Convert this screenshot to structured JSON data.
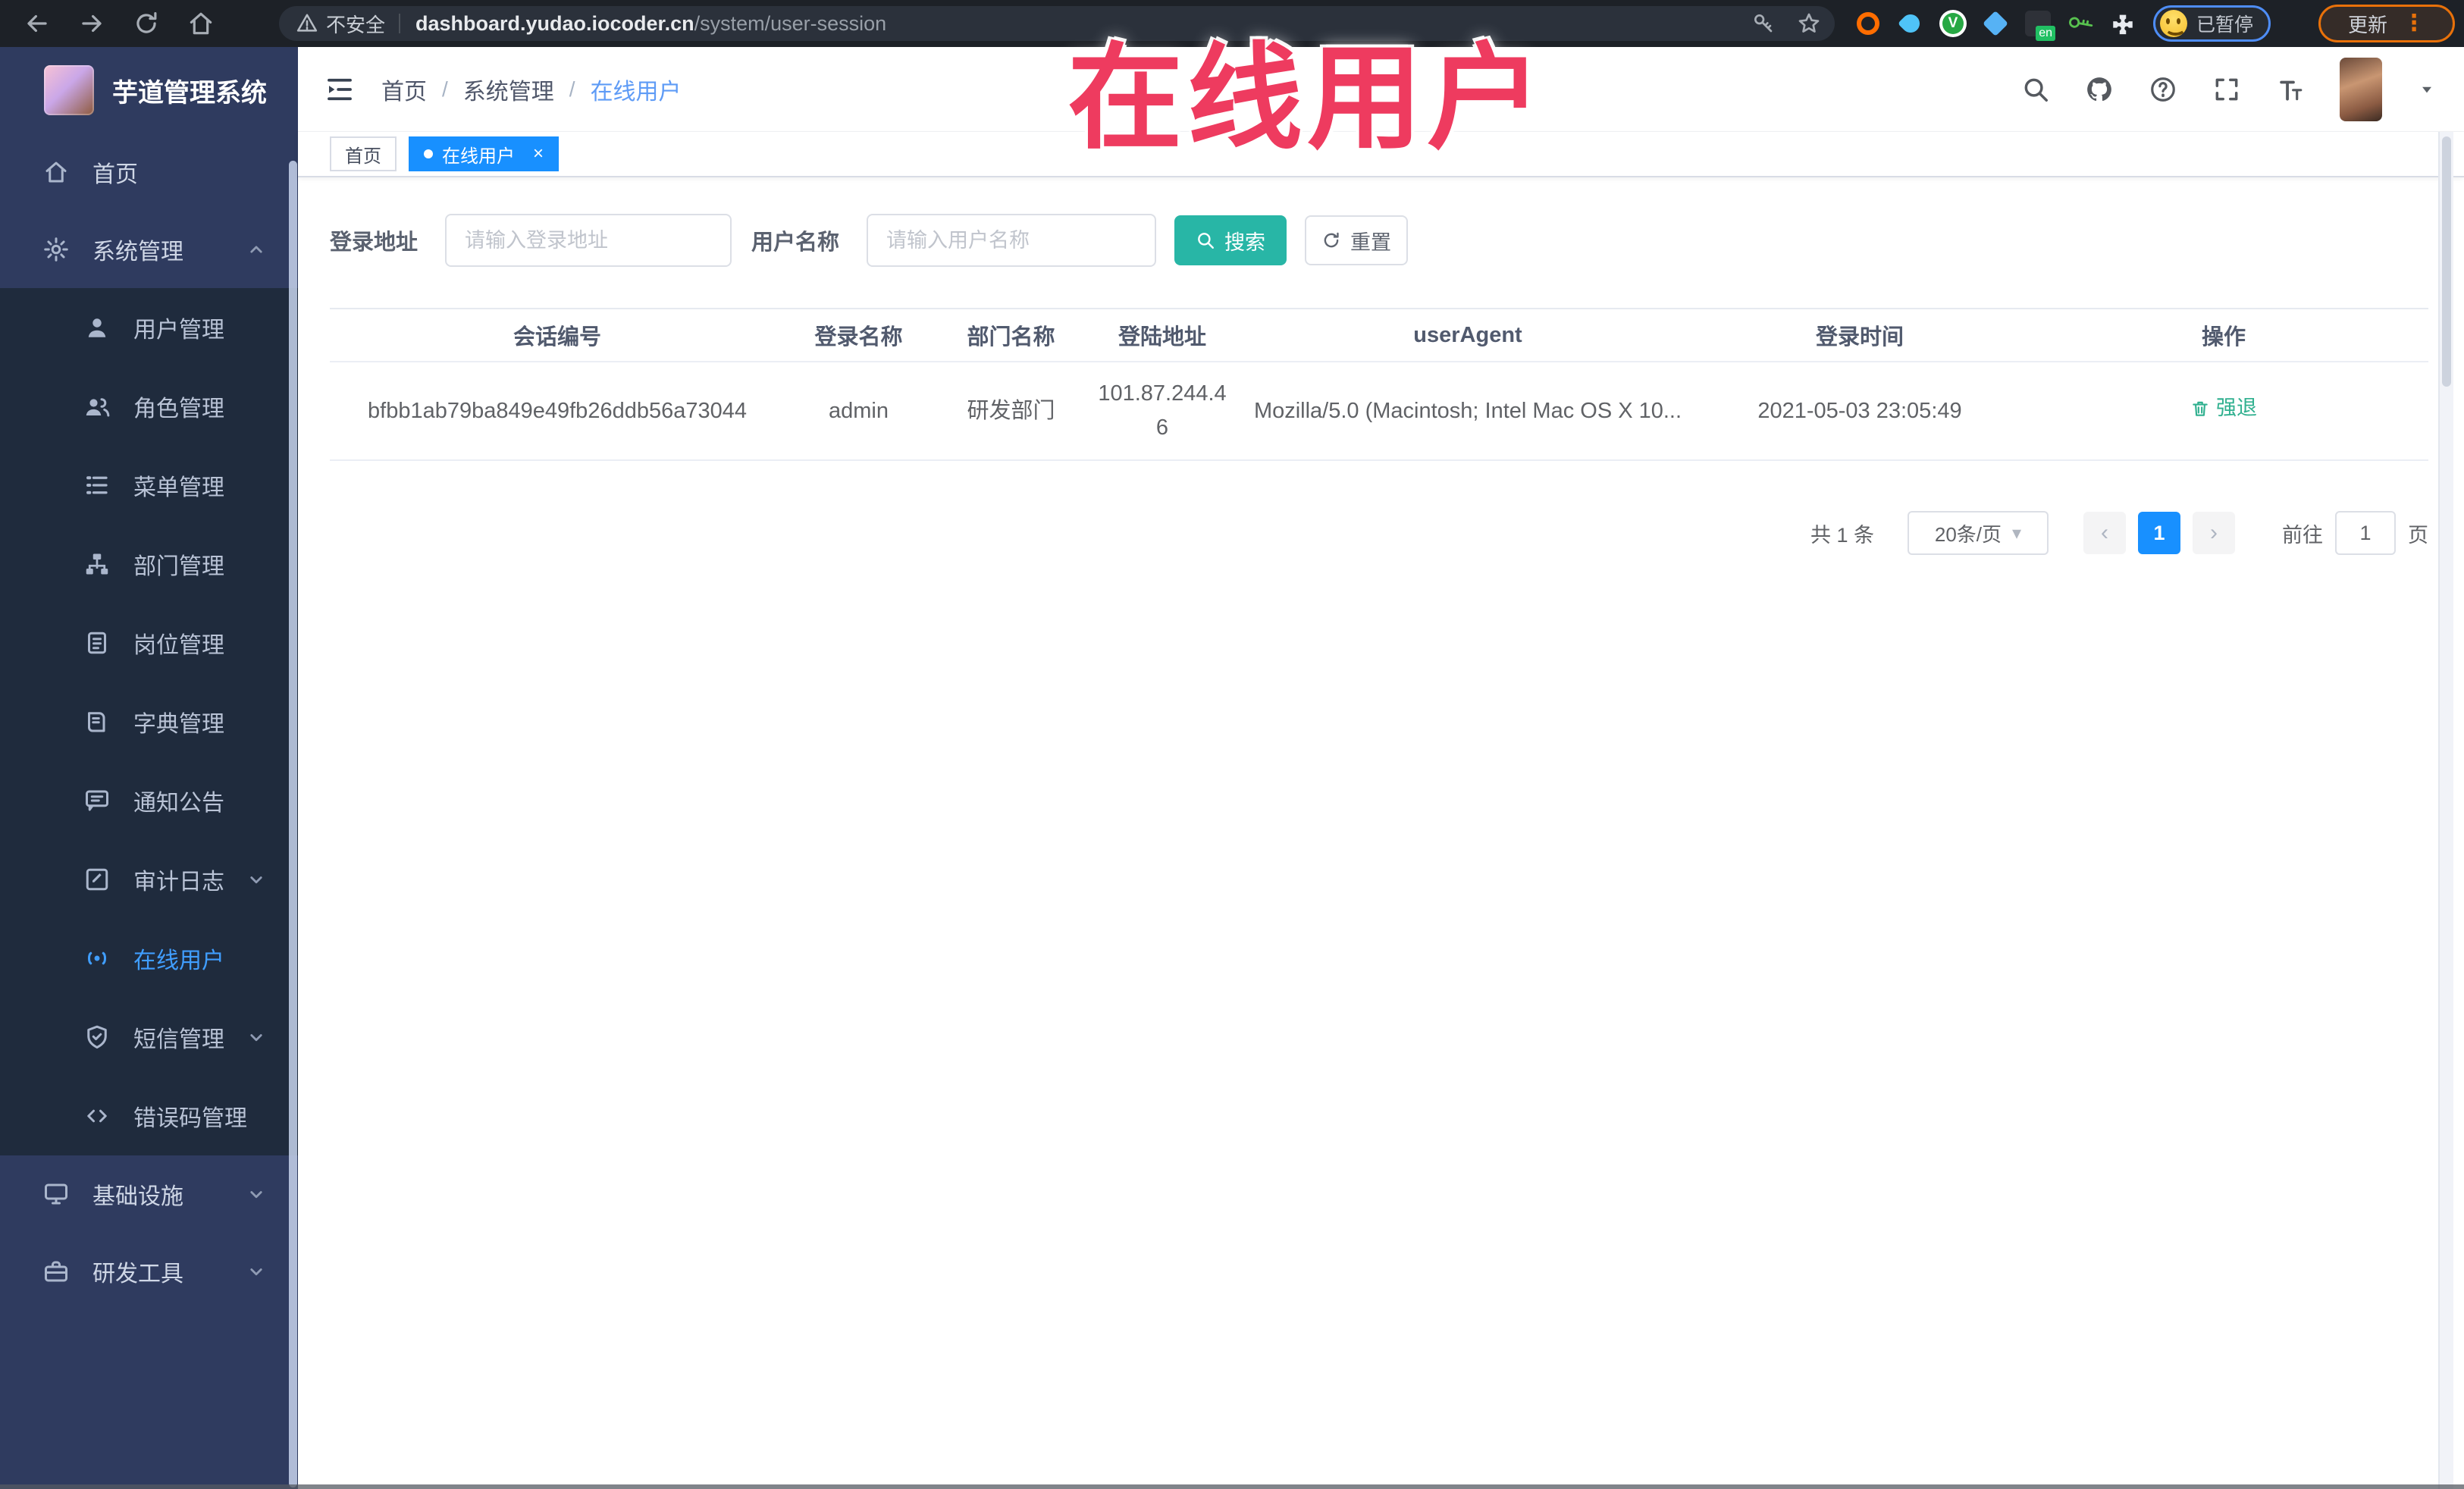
{
  "browser": {
    "security_label": "不安全",
    "url_domain": "dashboard.yudao.iocoder.cn",
    "url_path": "/system/user-session",
    "translate_badge": "en",
    "vpn_badge": "V",
    "profile_status": "已暂停",
    "update_label": "更新"
  },
  "watermark": {
    "text": "在线用户"
  },
  "sidebar": {
    "title": "芋道管理系统",
    "items": [
      {
        "label": "首页"
      },
      {
        "label": "系统管理"
      },
      {
        "label": "用户管理"
      },
      {
        "label": "角色管理"
      },
      {
        "label": "菜单管理"
      },
      {
        "label": "部门管理"
      },
      {
        "label": "岗位管理"
      },
      {
        "label": "字典管理"
      },
      {
        "label": "通知公告"
      },
      {
        "label": "审计日志"
      },
      {
        "label": "在线用户"
      },
      {
        "label": "短信管理"
      },
      {
        "label": "错误码管理"
      },
      {
        "label": "基础设施"
      },
      {
        "label": "研发工具"
      }
    ]
  },
  "header": {
    "breadcrumb": [
      "首页",
      "系统管理",
      "在线用户"
    ],
    "separator": "/"
  },
  "tabs": [
    {
      "label": "首页"
    },
    {
      "label": "在线用户"
    }
  ],
  "filters": {
    "address_label": "登录地址",
    "address_placeholder": "请输入登录地址",
    "name_label": "用户名称",
    "name_placeholder": "请输入用户名称",
    "search_label": "搜索",
    "reset_label": "重置"
  },
  "table": {
    "columns": [
      "会话编号",
      "登录名称",
      "部门名称",
      "登陆地址",
      "userAgent",
      "登录时间",
      "操作"
    ],
    "row": {
      "session_id": "bfbb1ab79ba849e49fb26ddb56a73044",
      "username": "admin",
      "dept": "研发部门",
      "ip": "101.87.244.46",
      "user_agent": "Mozilla/5.0 (Macintosh; Intel Mac OS X 10...",
      "login_time": "2021-05-03 23:05:49",
      "action_label": "强退"
    }
  },
  "pagination": {
    "total": "共 1 条",
    "page_size": "20条/页",
    "prev_glyph": "‹",
    "next_glyph": "›",
    "current_page": "1",
    "goto_label": "前往",
    "goto_value": "1",
    "page_label": "页"
  },
  "icons": {
    "close": "×",
    "kebab": "⋮",
    "caret": "▾"
  },
  "colors": {
    "accent_blue": "#1890ff",
    "menu_active": "#409eff",
    "search_teal": "#28b6a6",
    "action_green": "#30b08f",
    "watermark_red": "#ee3b5f"
  }
}
